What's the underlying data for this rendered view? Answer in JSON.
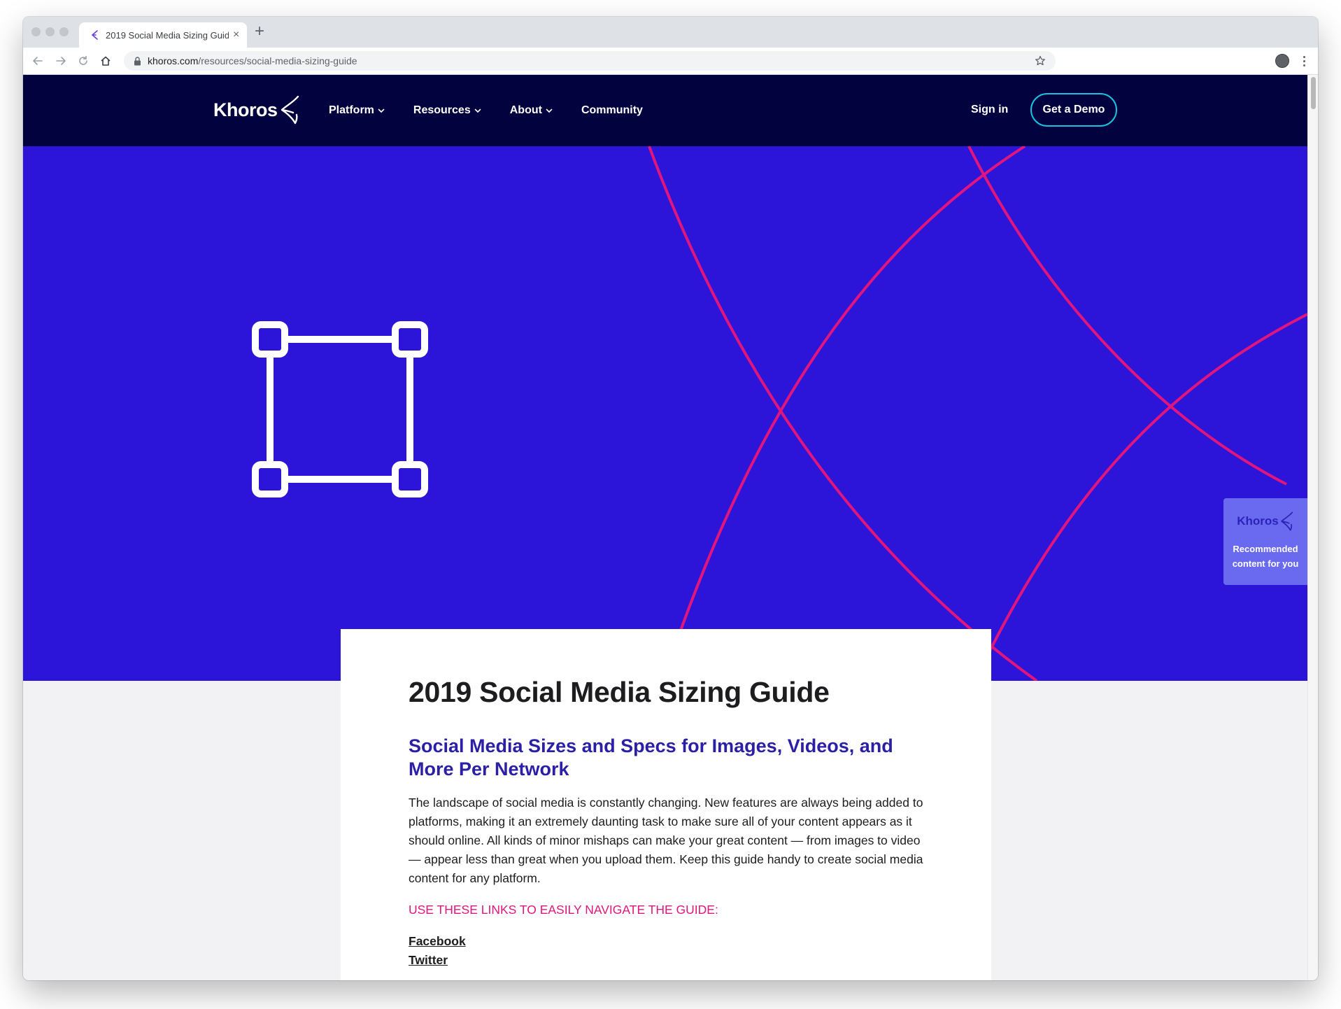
{
  "browser": {
    "tab_title": "2019 Social Media Sizing Guide",
    "tab_close": "×",
    "new_tab": "+",
    "url_host": "khoros.com",
    "url_path": "/resources/social-media-sizing-guide"
  },
  "site": {
    "logo": "Khoros",
    "nav": [
      {
        "label": "Platform",
        "has_dropdown": true
      },
      {
        "label": "Resources",
        "has_dropdown": true
      },
      {
        "label": "About",
        "has_dropdown": true
      },
      {
        "label": "Community",
        "has_dropdown": false
      }
    ],
    "sign_in": "Sign in",
    "demo_button": "Get a Demo"
  },
  "article": {
    "title": "2019 Social Media Sizing Guide",
    "subtitle": "Social Media Sizes and Specs for Images, Videos, and More Per Network",
    "body": "The landscape of social media is constantly changing. New features are always being added to platforms, making it an extremely daunting task to make sure all of your content appears as it should online. All kinds of minor mishaps can make your great content — from images to video — appear less than great when you upload them. Keep this guide handy to create social media content for any platform.",
    "nav_label": "USE THESE LINKS TO EASILY NAVIGATE THE GUIDE:",
    "links": [
      "Facebook",
      "Twitter"
    ]
  },
  "widget": {
    "logo": "Khoros",
    "line1": "Recommended",
    "line2": "content for you"
  },
  "colors": {
    "navbar": "#02023e",
    "hero": "#2c14d8",
    "hero_lines": "#e0157d",
    "accent_button": "#19c2de",
    "subtitle": "#2b1fa6",
    "nav_label": "#e0157d"
  },
  "icons": {
    "hero": "crop-frame-icon",
    "logo_mark": "khoros-mark-icon"
  }
}
